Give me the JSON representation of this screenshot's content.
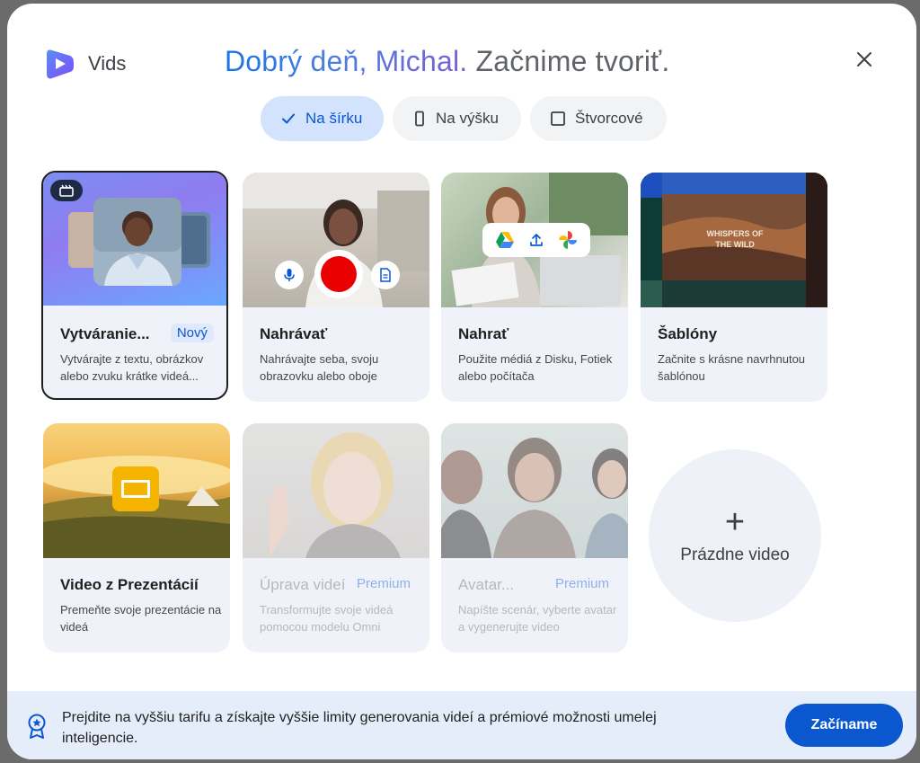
{
  "header": {
    "app_name": "Vids",
    "greeting_highlight": "Dobrý deň, Michal.",
    "greeting_rest": "Začnime tvoriť.",
    "close_icon": "close-icon"
  },
  "orientation": {
    "selected": "landscape",
    "options": [
      {
        "id": "landscape",
        "label": "Na šírku",
        "icon": "check-icon"
      },
      {
        "id": "portrait",
        "label": "Na výšku",
        "icon": "portrait-icon"
      },
      {
        "id": "square",
        "label": "Štvorcové",
        "icon": "square-icon"
      }
    ]
  },
  "cards": [
    {
      "title": "Vytváranie...",
      "badge": "Nový",
      "desc": "Vytvárajte z textu, obrázkov alebo zvuku krátke videá...",
      "icon": "clapperboard-icon",
      "selected": true
    },
    {
      "title": "Nahrávať",
      "desc": "Nahrávajte seba, svoju obrazovku alebo oboje",
      "icons": [
        "microphone-icon",
        "record-icon",
        "document-icon"
      ]
    },
    {
      "title": "Nahrať",
      "desc": "Použite médiá z Disku, Fotiek alebo počítača",
      "icons": [
        "google-drive-icon",
        "upload-icon",
        "google-photos-icon"
      ]
    },
    {
      "title": "Šablóny",
      "desc": "Začnite s krásne navrhnutou šablónou",
      "thumb_text": "WHISPERS OF\nTHE WILD"
    },
    {
      "title": "Video z Prezentácií",
      "desc": "Premeňte svoje prezentácie na videá",
      "icon": "slides-icon"
    },
    {
      "title": "Úprava videí",
      "badge": "Premium",
      "desc": "Transformujte svoje videá pomocou modelu Omni",
      "disabled": true
    },
    {
      "title": "Avatar...",
      "badge": "Premium",
      "desc": "Napíšte scenár, vyberte avatar a vygenerujte video",
      "disabled": true
    }
  ],
  "blank": {
    "plus": "+",
    "label": "Prázdne video"
  },
  "footer": {
    "icon": "premium-badge-icon",
    "text": "Prejdite na vyššiu tarifu a získajte vyššie limity generovania videí a prémiové možnosti umelej inteligencie.",
    "cta": "Začíname"
  },
  "colors": {
    "accent": "#0b57d0",
    "selected_chip": "#d3e3fd",
    "footer_bg": "#e5edfb"
  }
}
